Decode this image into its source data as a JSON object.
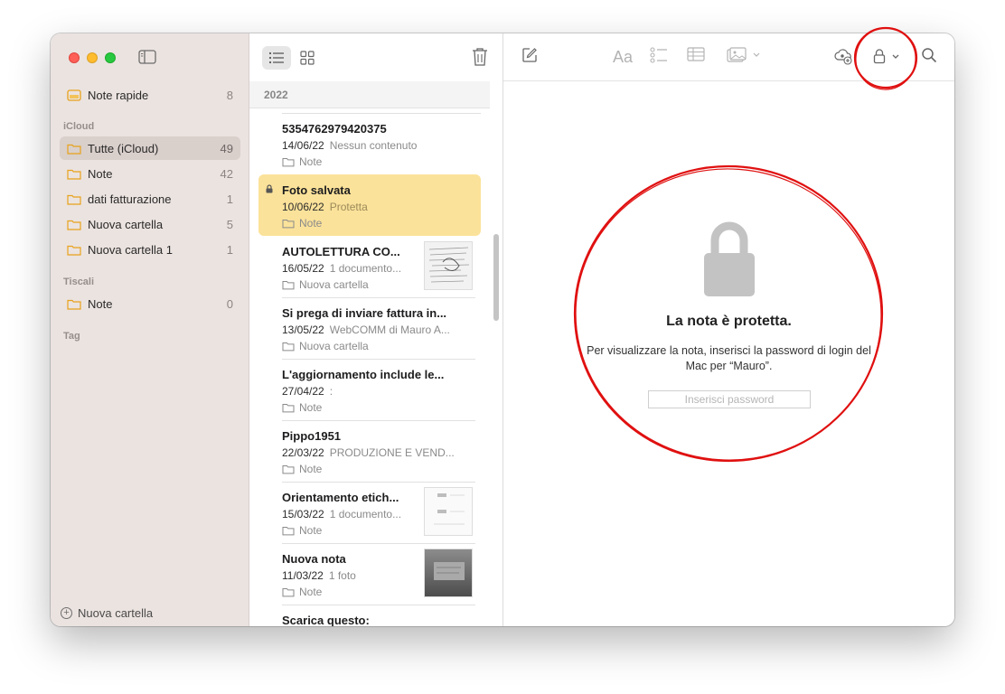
{
  "colors": {
    "accent_yellow": "#fbe29a",
    "folder_yellow": "#e8a21b",
    "sidebar_bg": "#ebe3e0",
    "annotation_red": "#e01010"
  },
  "sidebar": {
    "quick_notes": {
      "label": "Note rapide",
      "count": "8"
    },
    "section_icloud": "iCloud",
    "icloud_items": [
      {
        "label": "Tutte (iCloud)",
        "count": "49"
      },
      {
        "label": "Note",
        "count": "42"
      },
      {
        "label": "dati fatturazione",
        "count": "1"
      },
      {
        "label": "Nuova cartella",
        "count": "5"
      },
      {
        "label": "Nuova cartella 1",
        "count": "1"
      }
    ],
    "section_tiscali": "Tiscali",
    "tiscali_items": [
      {
        "label": "Note",
        "count": "0"
      }
    ],
    "section_tag": "Tag",
    "new_folder_label": "Nuova cartella"
  },
  "notelist": {
    "year": "2022",
    "notes": [
      {
        "title": "5354762979420375",
        "date": "14/06/22",
        "preview": "Nessun contenuto",
        "folder": "Note"
      },
      {
        "title": "Foto salvata",
        "date": "10/06/22",
        "preview": "Protetta",
        "folder": "Note"
      },
      {
        "title": "AUTOLETTURA CO...",
        "date": "16/05/22",
        "preview": "1 documento...",
        "folder": "Nuova cartella"
      },
      {
        "title": "Si prega di inviare fattura in...",
        "date": "13/05/22",
        "preview": "WebCOMM di Mauro A...",
        "folder": "Nuova cartella"
      },
      {
        "title": "L'aggiornamento include le...",
        "date": "27/04/22",
        "preview": ":",
        "folder": "Note"
      },
      {
        "title": "Pippo1951",
        "date": "22/03/22",
        "preview": "PRODUZIONE E VEND...",
        "folder": "Note"
      },
      {
        "title": "Orientamento etich...",
        "date": "15/03/22",
        "preview": "1 documento...",
        "folder": "Note"
      },
      {
        "title": "Nuova nota",
        "date": "11/03/22",
        "preview": "1 foto",
        "folder": "Note"
      },
      {
        "title": "Scarica questo:",
        "date": "",
        "preview": "",
        "folder": ""
      }
    ]
  },
  "editor": {
    "locked_title": "La nota è protetta.",
    "locked_message": "Per visualizzare la nota, inserisci la password di login del Mac per “Mauro”.",
    "password_placeholder": "Inserisci password",
    "password_value": "",
    "format_label": "Aa"
  }
}
